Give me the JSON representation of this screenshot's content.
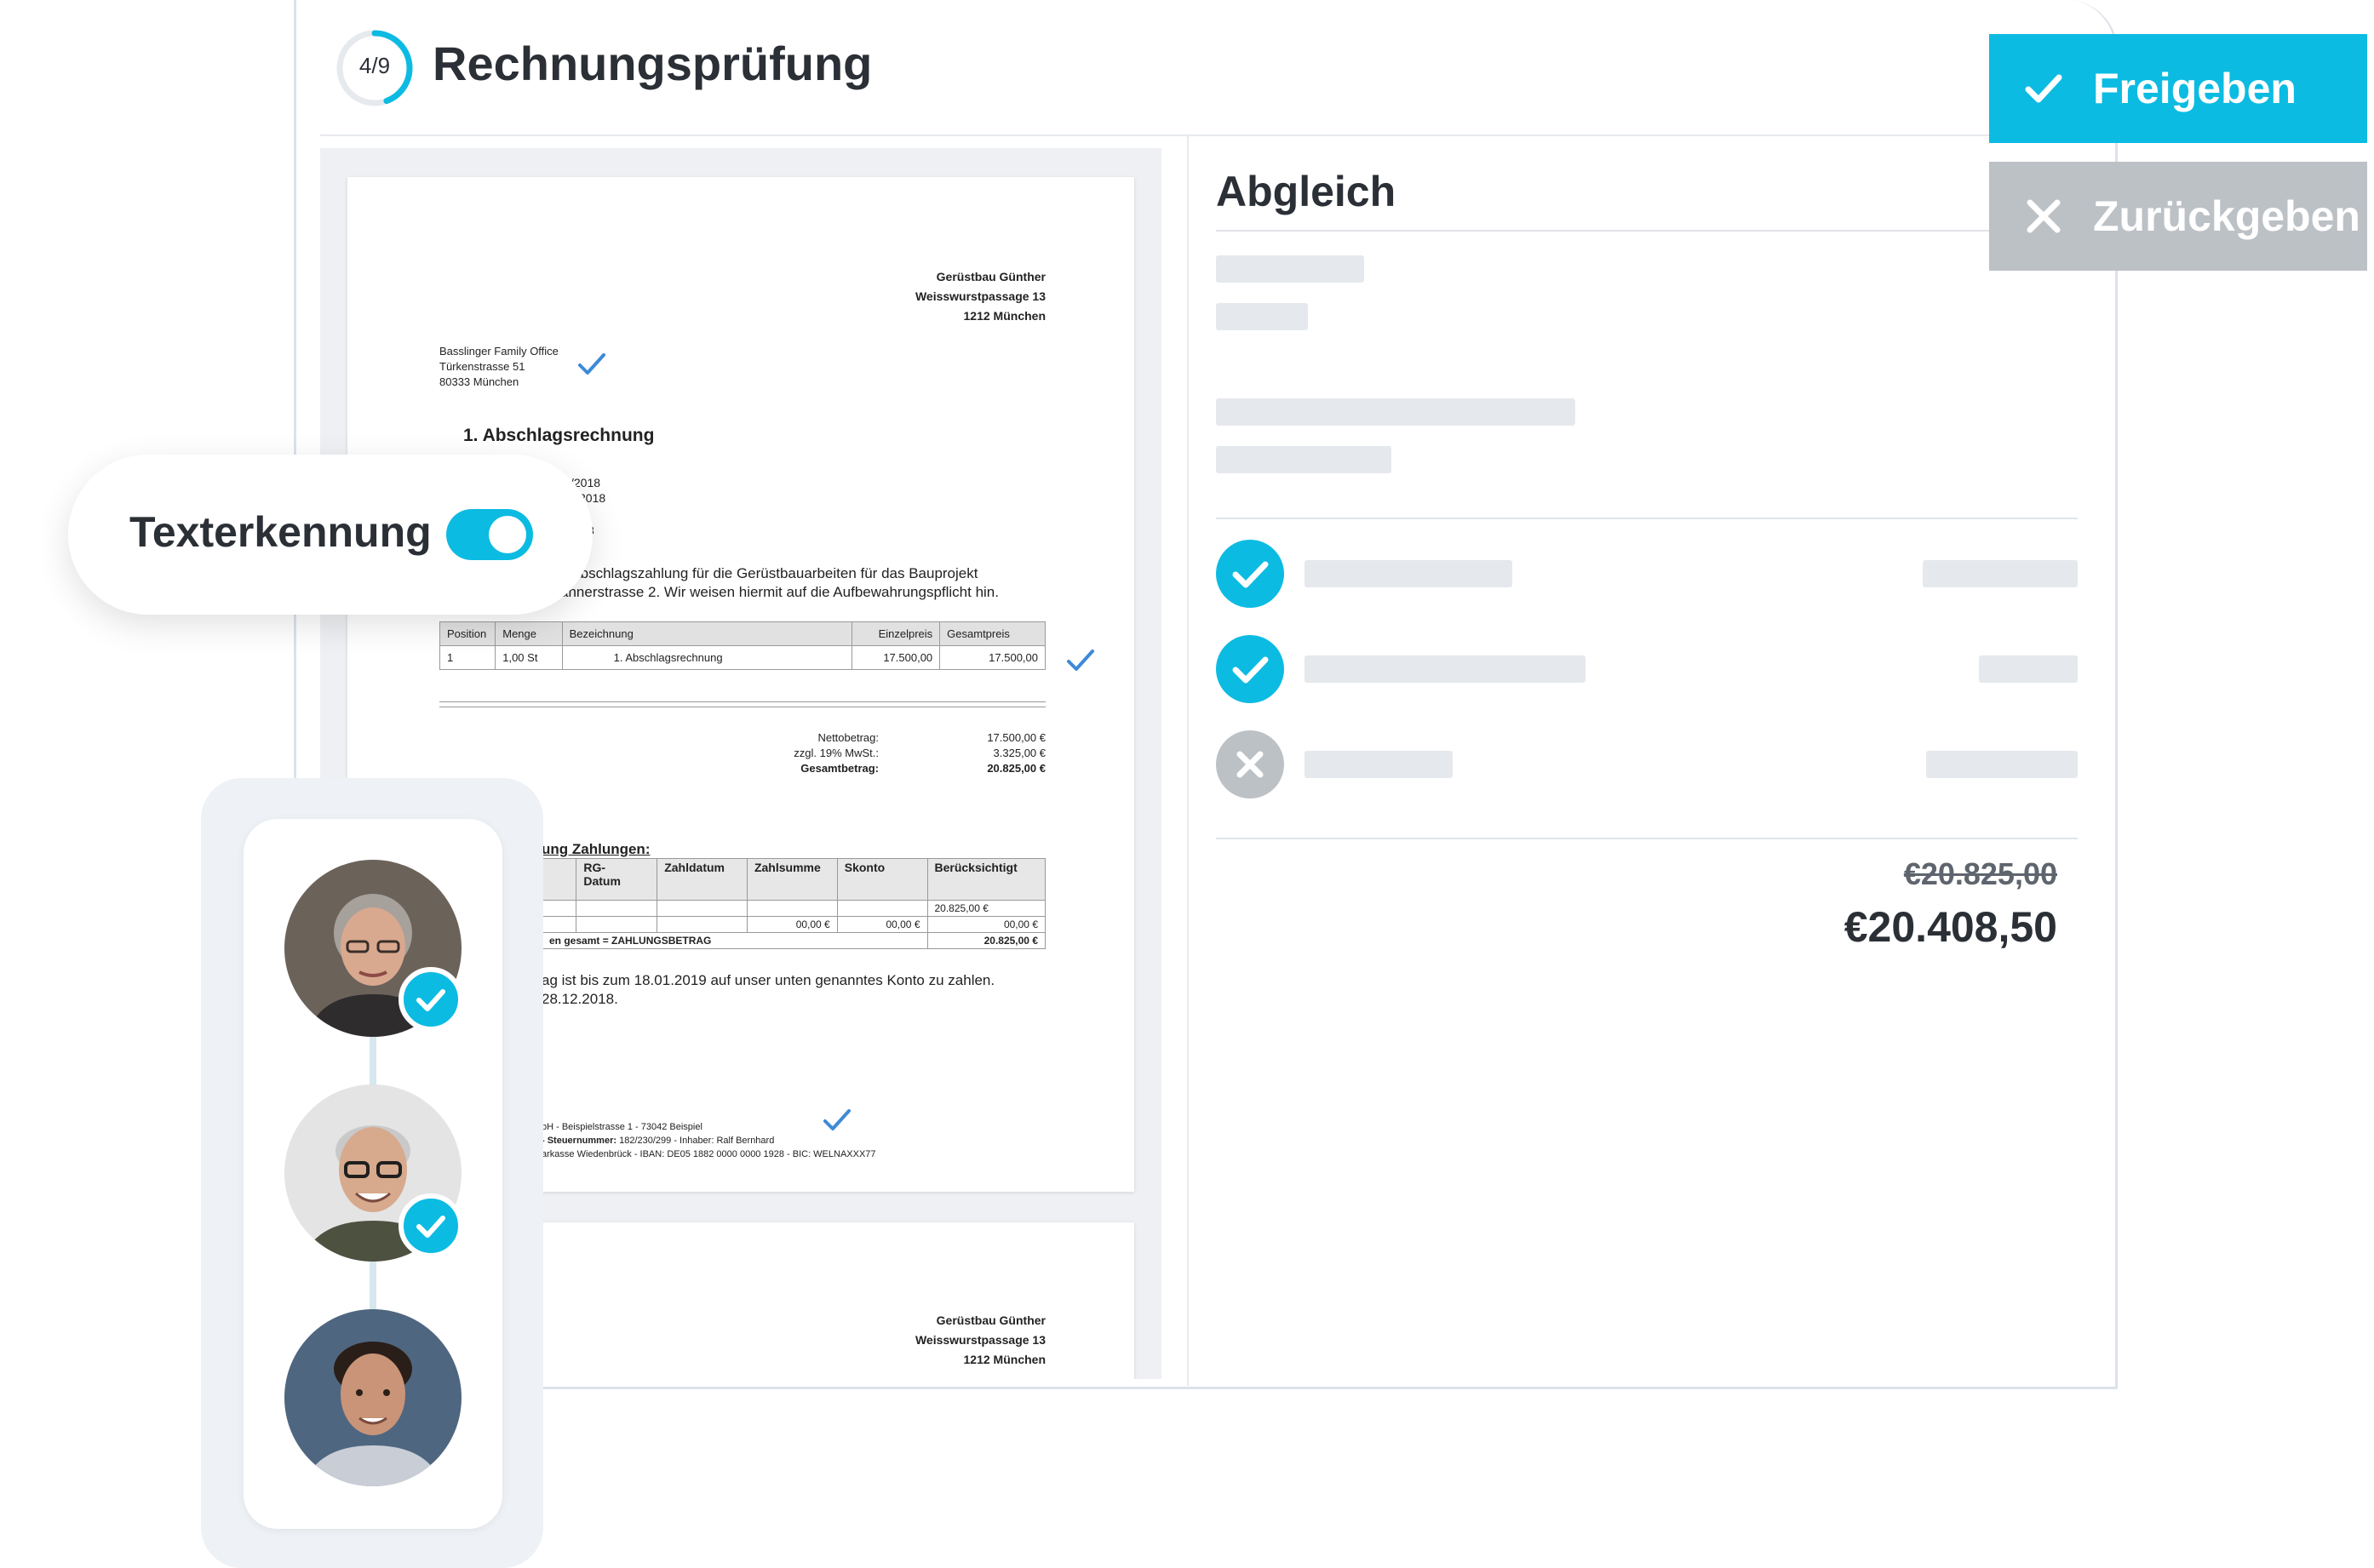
{
  "header": {
    "progress_text": "4/9",
    "progress_value": 0.444,
    "title": "Rechnungsprüfung"
  },
  "document": {
    "sender": [
      "Gerüstbau Günther",
      "Weisswurstpassage 13",
      "1212 München"
    ],
    "recipient": [
      "Basslinger Family Office",
      "Türkenstrasse 51",
      "80333 München"
    ],
    "invoice_title": "1.  Abschlagsrechnung",
    "partial_lines": [
      "/2018",
      "2018",
      "8"
    ],
    "body_lines": [
      "s Abschlagszahlung für die Gerüstbauarbeiten für das Bauprojekt",
      "annerstrasse 2. Wir weisen hiermit auf die Aufbewahrungspflicht hin."
    ],
    "items_table": {
      "headers": [
        "Position",
        "Menge",
        "Bezeichnung",
        "Einzelpreis",
        "Gesamtpreis"
      ],
      "rows": [
        [
          "1",
          "1,00 St",
          "1. Abschlagsrechnung",
          "17.500,00",
          "17.500,00"
        ]
      ]
    },
    "totals": [
      {
        "label": "Nettobetrag:",
        "value": "17.500,00 €"
      },
      {
        "label": "zzgl. 19% MwSt.:",
        "value": "3.325,00 €"
      },
      {
        "label": "Gesamtbetrag:",
        "value": "20.825,00 €"
      }
    ],
    "payments_heading": "ung Zahlungen:",
    "payments_table": {
      "headers": [
        "",
        "RG-\nDatum",
        "Zahldatum",
        "Zahlsumme",
        "Skonto",
        "Berücksichtigt"
      ],
      "row1": [
        "",
        "",
        "",
        "",
        "",
        "20.825,00 €"
      ],
      "row2": [
        "",
        "",
        "",
        "00,00 €",
        "00,00 €",
        "00,00 €"
      ],
      "total_label": "en gesamt = ZAHLUNGSBETRAG",
      "total_value": "20.825,00 €"
    },
    "payment_lines": [
      "ag ist bis zum 18.01.2019 auf unser unten genanntes Konto zu zahlen.",
      "28.12.2018."
    ],
    "footer_lines": [
      "bH - Beispielstrasse 1 - 73042 Beispiel",
      "- Steuernummer: 182/230/299 - Inhaber: Ralf Bernhard",
      "arkasse Wiedenbrück - IBAN: DE05 1882 0000 0000 1928 - BIC: WELNAXXX77"
    ],
    "footer_bold_fragment": "- Steuernummer:",
    "footer_rest": " 182/230/299 - Inhaber: Ralf Bernhard",
    "sender_page2": [
      "Gerüstbau Günther",
      "Weisswurstpassage 13",
      "1212 München"
    ]
  },
  "comparison": {
    "title": "Abgleich",
    "checks": [
      {
        "status": "ok",
        "icon": "check-icon"
      },
      {
        "status": "ok",
        "icon": "check-icon"
      },
      {
        "status": "failed",
        "icon": "close-icon"
      }
    ],
    "old_amount": "€20.825,00",
    "new_amount": "€20.408,50"
  },
  "actions": {
    "approve_label": "Freigeben",
    "return_label": "Zurückgeben"
  },
  "ocr": {
    "label": "Texterkennung",
    "enabled": true
  },
  "approvers": [
    {
      "name_icon": "avatar-woman",
      "approved": true
    },
    {
      "name_icon": "avatar-man-glasses",
      "approved": true
    },
    {
      "name_icon": "avatar-man-young",
      "approved": false
    }
  ],
  "colors": {
    "accent": "#0cbbe2",
    "muted": "#bcc1c6",
    "text": "#2b2f36",
    "placeholder": "#e5e8ec"
  }
}
